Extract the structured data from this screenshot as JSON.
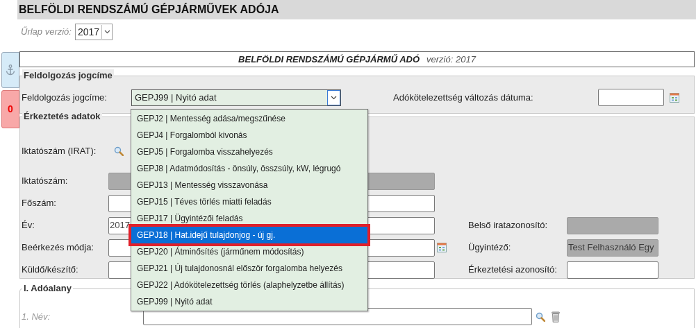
{
  "title": "BELFÖLDI RENDSZÁMÚ GÉPJÁRMŰVEK ADÓJA",
  "form_version": {
    "label": "Űrlap verzió:",
    "value": "2017"
  },
  "side_tabs": [
    {
      "kind": "anchor"
    },
    {
      "kind": "count",
      "text": "0"
    }
  ],
  "header": {
    "title": "BELFÖLDI RENDSZÁMÚ GÉPJÁRMŰ ADÓ",
    "version": "verzió: 2017"
  },
  "processing": {
    "legend": "Feldolgozás jogcíme",
    "label": "Feldolgozás jogcíme:",
    "value": "GEPJ99 | Nyitó adat",
    "expanded": true,
    "date_label": "Adókötelezettség változás dátuma:",
    "options": [
      {
        "text": "GEPJ2 | Mentesség adása/megszűnése",
        "highlighted": false
      },
      {
        "text": "GEPJ4 | Forgalomból kivonás",
        "highlighted": false
      },
      {
        "text": "GEPJ5 | Forgalomba visszahelyezés",
        "highlighted": false
      },
      {
        "text": "GEPJ8 | Adatmódosítás - önsúly, összsúly, kW, légrugó",
        "highlighted": false
      },
      {
        "text": "GEPJ13 | Mentesség visszavonása",
        "highlighted": false
      },
      {
        "text": "GEPJ15 | Téves törlés miatti feladás",
        "highlighted": false
      },
      {
        "text": "GEPJ17 | Ügyintézői feladás",
        "highlighted": false
      },
      {
        "text": "GEPJ18 | Hat.idejű tulajdonjog - új gj.",
        "highlighted": true
      },
      {
        "text": "GEPJ20 | Átminősítés (járműnem módosítás)",
        "highlighted": false
      },
      {
        "text": "GEPJ21 | Új tulajdonosnál először forgalomba helyezés",
        "highlighted": false
      },
      {
        "text": "GEPJ22 | Adókötelezettség törlés (alaphelyzetbe állítás)",
        "highlighted": false
      },
      {
        "text": "GEPJ99 | Nyitó adat",
        "highlighted": false
      }
    ]
  },
  "arrival": {
    "legend": "Érkeztetés adatok",
    "rows": [
      {
        "label": "Iktatószám (IRAT):",
        "kind": "search"
      },
      {
        "label": "Iktatószám:",
        "kind": "input",
        "disabled": true
      },
      {
        "label": "Főszám:",
        "kind": "input",
        "disabled": false
      },
      {
        "label": "Év:",
        "kind": "input",
        "disabled": false,
        "value": "2017",
        "right": {
          "label": "Belső iratazonosító:",
          "disabled": true
        }
      },
      {
        "label": "Beérkezés módja:",
        "kind": "date",
        "disabled": false,
        "right": {
          "label": "Ügyintéző:",
          "disabled": true,
          "value": "Test Felhasználó Egy"
        }
      },
      {
        "label": "Küldő/készítő:",
        "kind": "input",
        "disabled": false,
        "right": {
          "label": "Érkeztetési azonosító:",
          "disabled": false
        }
      }
    ]
  },
  "subject": {
    "legend": "I. Adóalany",
    "name_label": "1. Név:"
  }
}
